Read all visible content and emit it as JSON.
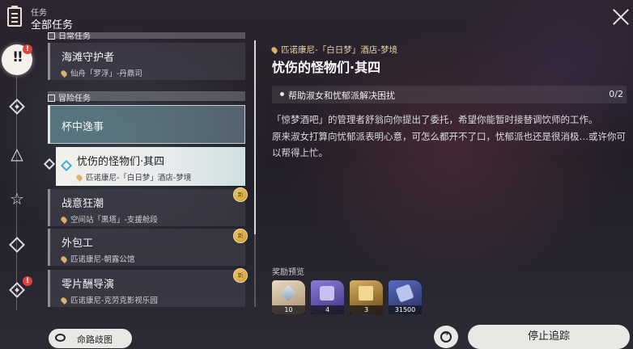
{
  "header": {
    "section_label": "任务",
    "title": "全部任务"
  },
  "left_rail": {
    "items": [
      {
        "icon": "all-missions-icon",
        "alert": "!",
        "active_text": "!!"
      },
      {
        "icon": "trailblaze-mission-icon"
      },
      {
        "icon": "companion-mission-icon"
      },
      {
        "icon": "adventure-mission-icon"
      },
      {
        "icon": "daily-mission-icon"
      },
      {
        "icon": "event-mission-icon",
        "alert": "!"
      }
    ]
  },
  "mission_list": {
    "category_daily": "日常任务",
    "category_adventure": "冒险任务",
    "items": [
      {
        "title": "海滩守护者",
        "location": "仙舟「罗浮」-丹鼎司"
      },
      {
        "title": "杯中逸事"
      },
      {
        "title": "忧伤的怪物们·其四",
        "location": "匹诺康尼-「白日梦」酒店-梦境"
      },
      {
        "title": "战意狂潮",
        "location": "空间站「黑塔」-支援舱段",
        "badge": "新"
      },
      {
        "title": "外包工",
        "location": "匹诺康尼-朝露公馆",
        "badge": "新"
      },
      {
        "title": "零片酬导演",
        "location": "匹诺康尼-克劳克影视乐园",
        "badge": "新"
      }
    ]
  },
  "detail": {
    "location": "匹诺康尼-「白日梦」酒店-梦境",
    "title": "忧伤的怪物们·其四",
    "objective": "帮助淑女和忧郁派解决困扰",
    "objective_progress": "0/2",
    "description_1": "「惊梦酒吧」的管理者舒翁向你提出了委托，希望你能暂时接替调饮师的工作。",
    "description_2": "原来淑女打算向忧郁派表明心意，可怎么都开不了口，忧郁派也还是很消极…或许你可以帮得上忙。",
    "rewards_label": "奖励预览",
    "rewards": [
      {
        "icon": "trailblaze-exp-icon",
        "count": "10",
        "color": "#c9b7a0"
      },
      {
        "icon": "traveler-guide-icon",
        "count": "4",
        "color": "#5e4fa0"
      },
      {
        "icon": "credit-icon",
        "count": "3",
        "color": "#8a6a2a"
      },
      {
        "icon": "credits-icon",
        "count": "31500",
        "color": "#3a4a8a"
      }
    ]
  },
  "footer": {
    "map_button": "命路歧图",
    "stop_tracking": "停止追踪"
  }
}
